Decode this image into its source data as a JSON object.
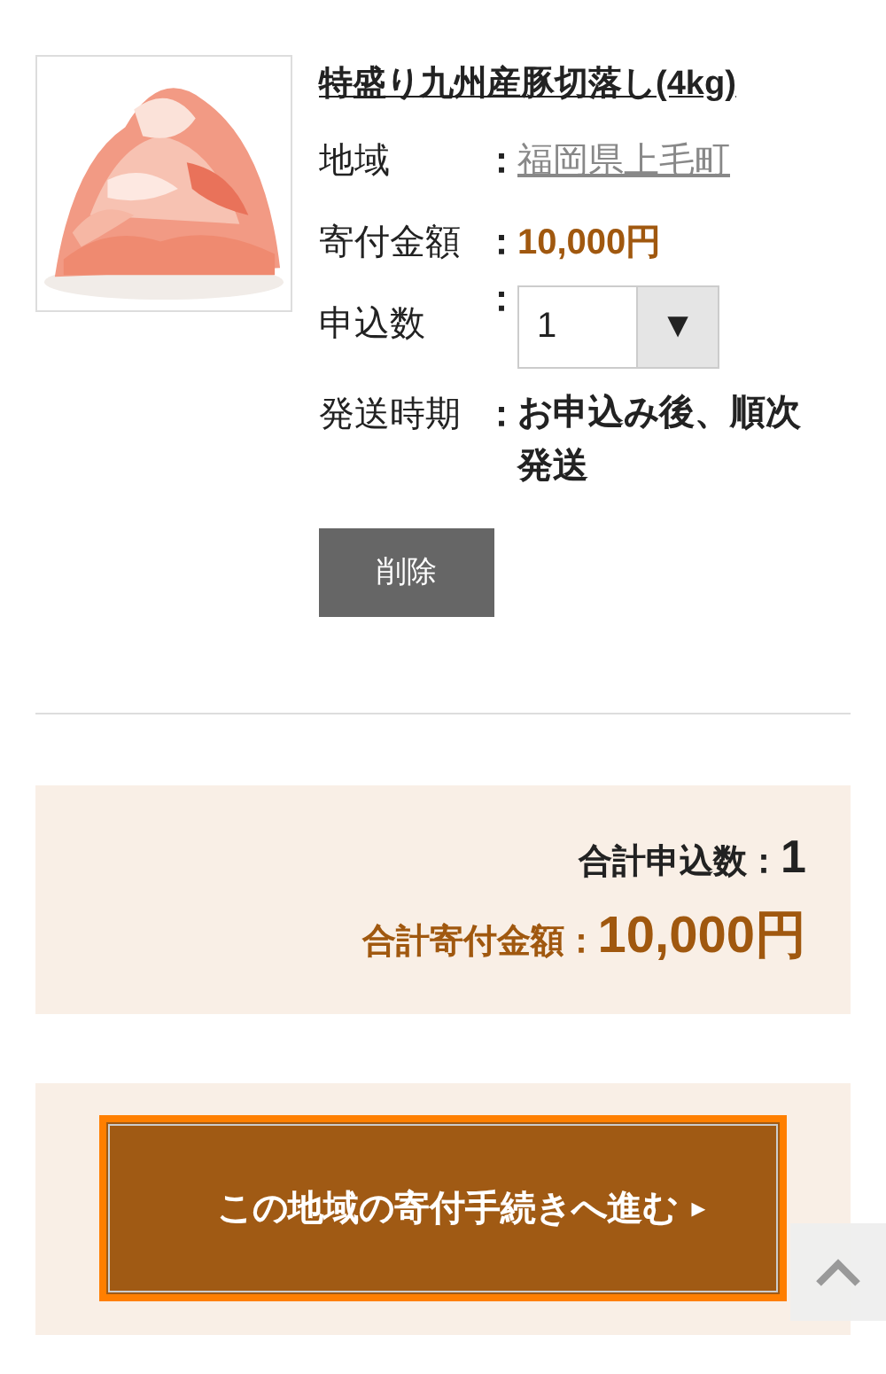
{
  "item": {
    "title": "特盛り九州産豚切落し(4kg)",
    "fields": [
      {
        "kind": "link",
        "label": "地域",
        "colon": "：",
        "value": "福岡県上毛町"
      },
      {
        "kind": "price",
        "label": "寄付金額",
        "colon": "：",
        "value": "10,000円"
      },
      {
        "kind": "select",
        "label": "申込数",
        "colon": "：",
        "value": "1",
        "arrow": "▼"
      },
      {
        "kind": "bold",
        "label": "発送時期",
        "colon": "：",
        "value": "お申込み後、順次発送"
      }
    ],
    "delete_button": "削除"
  },
  "summary": {
    "count_label": "合計申込数：",
    "count": "1",
    "amount_label": "合計寄付金額：",
    "amount": "10,000円"
  },
  "proceed_button": {
    "label": "この地域の寄付手続きへ進む",
    "arrow": "▸",
    "focused": true
  }
}
